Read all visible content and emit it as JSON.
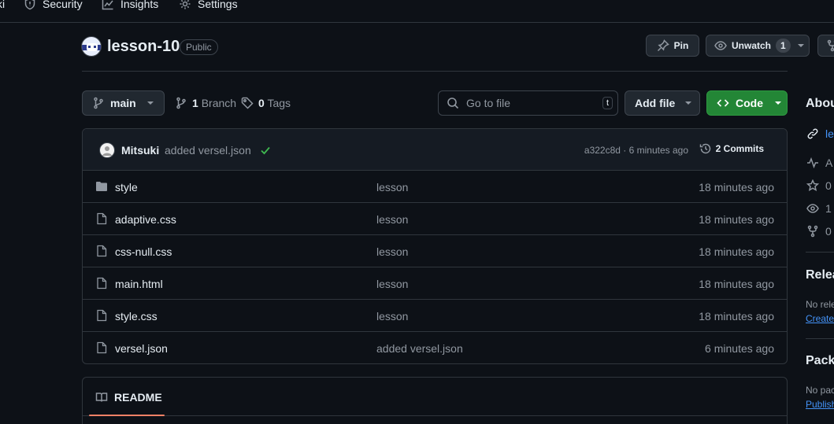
{
  "nav": {
    "items": [
      {
        "label": "ki",
        "icon": "wiki-icon"
      },
      {
        "label": "Security",
        "icon": "shield-icon"
      },
      {
        "label": "Insights",
        "icon": "graph-icon"
      },
      {
        "label": "Settings",
        "icon": "gear-icon"
      }
    ]
  },
  "repo": {
    "name": "lesson-10",
    "visibility": "Public",
    "pin_label": "Pin",
    "unwatch_label": "Unwatch",
    "watch_count": "1"
  },
  "toolbar": {
    "branch": "main",
    "branches_count": "1",
    "branches_label": "Branch",
    "tags_count": "0",
    "tags_label": "Tags",
    "search_placeholder": "Go to file",
    "search_shortcut": "t",
    "add_file_label": "Add file",
    "code_label": "Code"
  },
  "commit": {
    "author": "Mitsuki",
    "message": "added versel.json",
    "status": "success",
    "meta": "a322c8d · 6 minutes ago",
    "commits_label": "2 Commits"
  },
  "files": [
    {
      "type": "dir",
      "name": "style",
      "message": "lesson",
      "date": "18 minutes ago"
    },
    {
      "type": "file",
      "name": "adaptive.css",
      "message": "lesson",
      "date": "18 minutes ago"
    },
    {
      "type": "file",
      "name": "css-null.css",
      "message": "lesson",
      "date": "18 minutes ago"
    },
    {
      "type": "file",
      "name": "main.html",
      "message": "lesson",
      "date": "18 minutes ago"
    },
    {
      "type": "file",
      "name": "style.css",
      "message": "lesson",
      "date": "18 minutes ago"
    },
    {
      "type": "file",
      "name": "versel.json",
      "message": "added versel.json",
      "date": "6 minutes ago"
    }
  ],
  "readme": {
    "tab_label": "README"
  },
  "sidebar": {
    "about_heading": "Abou",
    "link_text": "le",
    "stats": [
      "A",
      "0",
      "1",
      "0"
    ],
    "releases_heading": "Relea",
    "releases_text": "No rele",
    "releases_link": "Create",
    "packages_heading": "Packa",
    "packages_text": "No pac",
    "packages_link": "Publish"
  },
  "colors": {
    "background": "#0d1117",
    "border": "#30363d",
    "code_button": "#238636",
    "link": "#4493f8",
    "active_tab_underline": "#f78166",
    "success_check": "#3fb950"
  }
}
